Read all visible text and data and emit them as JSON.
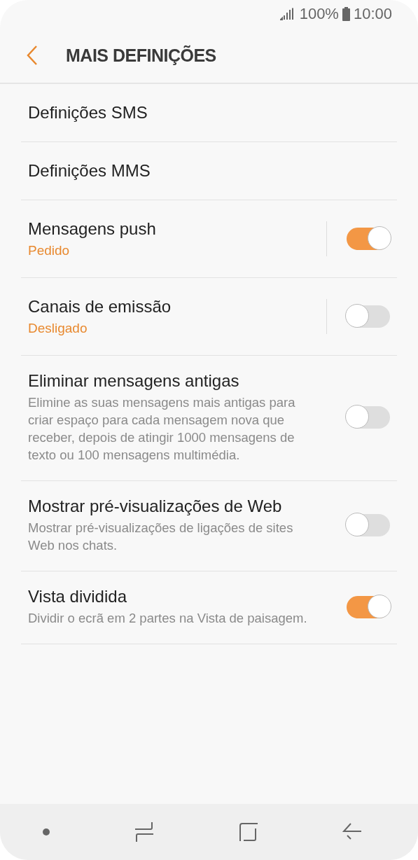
{
  "status_bar": {
    "battery": "100%",
    "time": "10:00"
  },
  "header": {
    "title": "MAIS DEFINIÇÕES"
  },
  "items": [
    {
      "kind": "link",
      "title": "Definições SMS"
    },
    {
      "kind": "link",
      "title": "Definições MMS"
    },
    {
      "kind": "split_switch",
      "title": "Mensagens push",
      "status": "Pedido",
      "on": true
    },
    {
      "kind": "split_switch",
      "title": "Canais de emissão",
      "status": "Desligado",
      "on": false
    },
    {
      "kind": "switch",
      "title": "Eliminar mensagens antigas",
      "description": "Elimine as suas mensagens mais antigas para criar espaço para cada mensagem nova que receber, depois de atingir 1000 mensagens de texto ou 100 mensagens multimédia.",
      "on": false
    },
    {
      "kind": "switch",
      "title": "Mostrar pré-visualizações de Web",
      "description": "Mostrar pré-visualizações de ligações de sites Web nos chats.",
      "on": false
    },
    {
      "kind": "switch",
      "title": "Vista dividida",
      "description": "Dividir o ecrã em 2 partes na Vista de paisagem.",
      "on": true
    }
  ]
}
